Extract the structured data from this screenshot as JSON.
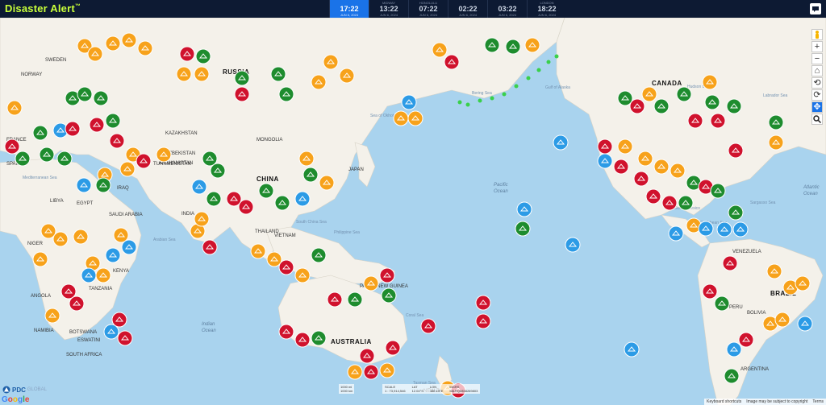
{
  "app": {
    "title": "Disaster Alert",
    "trademark": "™"
  },
  "timeline": [
    {
      "label": "",
      "time": "17:22",
      "date": "JUN 6, 2024",
      "current": true
    },
    {
      "label": "MIDWAY",
      "time": "13:22",
      "date": "JUN 6, 2024",
      "current": false
    },
    {
      "label": "HONOLULU",
      "time": "07:22",
      "date": "JUN 6, 2024",
      "current": false
    },
    {
      "label": "",
      "time": "02:22",
      "date": "JUN 6, 2024",
      "current": false
    },
    {
      "label": "",
      "time": "03:22",
      "date": "JUN 6, 2024",
      "current": false
    },
    {
      "label": "LONDON",
      "time": "18:22",
      "date": "JUN 6, 2024",
      "current": false
    }
  ],
  "map_labels": {
    "oceans": [
      {
        "text": "Pacific",
        "sub": "Ocean"
      },
      {
        "text": "Indian",
        "sub": "Ocean"
      },
      {
        "text": "Atlantic",
        "sub": "Ocean"
      }
    ],
    "countries": [
      "RUSSIA",
      "CHINA",
      "AUSTRALIA",
      "CANADA",
      "BRAZIL",
      "ARGENTINA",
      "KAZAKHSTAN",
      "MONGOLIA",
      "INDIA",
      "SOUTH AFRICA",
      "TANZANIA",
      "JAPAN",
      "EGYPT",
      "LIBYA",
      "IRAQ",
      "SAUDI ARABIA",
      "AFGHANISTAN",
      "SWEDEN",
      "NORWAY",
      "THAILAND",
      "VIETNAM",
      "PERU",
      "BOLIVIA",
      "VENEZUELA",
      "NEW ZEALAND",
      "NAMIBIA",
      "ANGOLA",
      "KENYA",
      "PAPUA NEW GUINEA",
      "FRANCE",
      "SPAIN",
      "NIGER",
      "TURKMENISTAN",
      "UZBEKISTAN",
      "BOTSWANA",
      "ESWATINI"
    ],
    "seas": [
      "Bering Sea",
      "Gulf of Alaska",
      "Hudson Bay",
      "Labrador Sea",
      "Sea of Okhotsk",
      "Philippine Sea",
      "Coral Sea",
      "Tasman Sea",
      "Arabian Sea",
      "Mediterranean Sea",
      "South China Sea",
      "Sargasso Sea",
      "Caribbean Sea",
      "Gulf of Mexico"
    ]
  },
  "controls": {
    "zoom_in": "+",
    "zoom_out": "−",
    "home": "⌂",
    "rotate": "⟲",
    "reset": "⟳",
    "pan": "✥",
    "search": "🔍"
  },
  "footer": {
    "pdc_name": "PDC",
    "pdc_sub": "GLOBAL",
    "google": "Google",
    "scale_top": "1000 mi",
    "scale_bottom": "1000 km",
    "readout": [
      {
        "label": "SCALE",
        "value": "1 : 73,914,546"
      },
      {
        "label": "LAT",
        "value": "12.04°S"
      },
      {
        "label": "LON",
        "value": "169.19°E"
      },
      {
        "label": "MGRS",
        "value": "58LRQ6858269803"
      }
    ],
    "attribution": [
      "Keyboard shortcuts",
      "Image may be subject to copyright",
      "Terms"
    ]
  },
  "colors": {
    "ocean": "#a9d3ee",
    "land": "#f4f1ea",
    "topbar": "#0d1a33",
    "brand": "#c9ff3a",
    "hazard_red": "#d0122d",
    "hazard_orange": "#f7a21b",
    "hazard_green": "#1e8c2e",
    "hazard_blue": "#2c9be6"
  }
}
